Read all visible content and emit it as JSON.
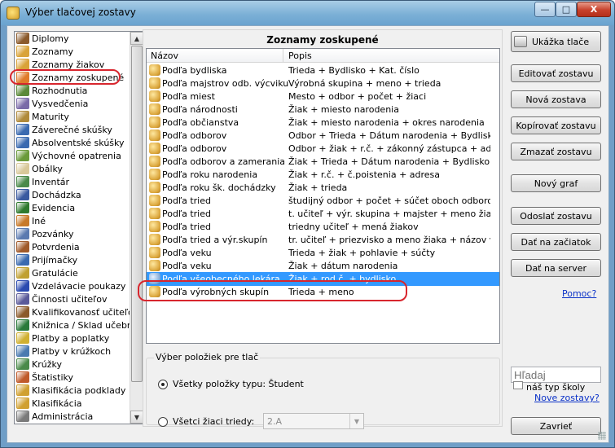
{
  "window": {
    "title": "Výber tlačovej zostavy",
    "controls": {
      "minimize": "—",
      "maximize": "□",
      "close": "X"
    }
  },
  "sidebar": {
    "items": [
      {
        "label": "Diplomy",
        "icon": "diploma-icon",
        "color": "#8b5a2b"
      },
      {
        "label": "Zoznamy",
        "icon": "list-icon",
        "color": "#d9a338"
      },
      {
        "label": "Zoznamy žiakov",
        "icon": "students-list-icon",
        "color": "#d9a338"
      },
      {
        "label": "Zoznamy zoskupené",
        "icon": "grouped-list-icon",
        "color": "#e07b2a"
      },
      {
        "label": "Rozhodnutia",
        "icon": "decision-icon",
        "color": "#5c8a3a"
      },
      {
        "label": "Vysvedčenia",
        "icon": "certificate-icon",
        "color": "#7a6aa8"
      },
      {
        "label": "Maturity",
        "icon": "graduation-icon",
        "color": "#b08a3a"
      },
      {
        "label": "Záverečné skúšky",
        "icon": "final-exam-icon",
        "color": "#3a6ab0"
      },
      {
        "label": "Absolventské skúšky",
        "icon": "graduate-exam-icon",
        "color": "#3a6ab0"
      },
      {
        "label": "Výchovné opatrenia",
        "icon": "measures-icon",
        "color": "#6a9a3a"
      },
      {
        "label": "Obálky",
        "icon": "envelope-icon",
        "color": "#d8c89a"
      },
      {
        "label": "Inventár",
        "icon": "inventory-icon",
        "color": "#4a8a4a"
      },
      {
        "label": "Dochádzka",
        "icon": "attendance-icon",
        "color": "#3a5aa0"
      },
      {
        "label": "Evidencia",
        "icon": "records-icon",
        "color": "#2f7a2f"
      },
      {
        "label": "Iné",
        "icon": "other-icon",
        "color": "#c87a2a"
      },
      {
        "label": "Pozvánky",
        "icon": "invitation-icon",
        "color": "#5a7ab0"
      },
      {
        "label": "Potvrdenia",
        "icon": "confirmation-icon",
        "color": "#a05a2a"
      },
      {
        "label": "Prijímačky",
        "icon": "admissions-icon",
        "color": "#3a6ab0"
      },
      {
        "label": "Gratulácie",
        "icon": "congratulation-icon",
        "color": "#c0a030"
      },
      {
        "label": "Vzdelávacie poukazy",
        "icon": "voucher-icon",
        "color": "#2a4ab0"
      },
      {
        "label": "Činnosti učiteľov",
        "icon": "teacher-activity-icon",
        "color": "#5a5a9a"
      },
      {
        "label": "Kvalifikovanosť učiteľov",
        "icon": "qualification-icon",
        "color": "#8b5a2b"
      },
      {
        "label": "Knižnica / Sklad učebníc",
        "icon": "library-icon",
        "color": "#2a7a3a"
      },
      {
        "label": "Platby a poplatky",
        "icon": "payment-icon",
        "color": "#d0b030"
      },
      {
        "label": "Platby v krúžkoch",
        "icon": "club-payment-icon",
        "color": "#4a7ab0"
      },
      {
        "label": "Krúžky",
        "icon": "clubs-icon",
        "color": "#4a8a4a"
      },
      {
        "label": "Štatistiky",
        "icon": "statistics-icon",
        "color": "#c05a2a"
      },
      {
        "label": "Klasifikácia podklady",
        "icon": "grading-docs-icon",
        "color": "#d0a030"
      },
      {
        "label": "Klasifikácia",
        "icon": "grading-icon",
        "color": "#d0a030"
      },
      {
        "label": "Administrácia",
        "icon": "administration-icon",
        "color": "#7a7a7a"
      }
    ],
    "scroll_up": "▲",
    "scroll_down": "▼"
  },
  "main": {
    "title": "Zoznamy zoskupené",
    "columns": {
      "name": "Názov",
      "description": "Popis"
    },
    "rows": [
      {
        "name": "Podľa bydliska",
        "desc": "Trieda + Bydlisko + Kat. číslo"
      },
      {
        "name": "Podľa majstrov odb. výcviku",
        "desc": "Výrobná skupina + meno + trieda"
      },
      {
        "name": "Podľa miest",
        "desc": "Mesto + odbor + počet + žiaci"
      },
      {
        "name": "Podľa národnosti",
        "desc": "Žiak + miesto narodenia"
      },
      {
        "name": "Podľa občianstva",
        "desc": "Žiak + miesto narodenia + okres narodenia"
      },
      {
        "name": "Podľa odborov",
        "desc": "Odbor + Trieda + Dátum narodenia + Bydlisko"
      },
      {
        "name": "Podľa odborov",
        "desc": "Odbor + žiak + r.č. + zákonný zástupca + adresa"
      },
      {
        "name": "Podľa odborov a zamerania",
        "desc": "Žiak + Trieda + Dátum narodenia + Bydlisko"
      },
      {
        "name": "Podľa roku narodenia",
        "desc": "Žiak + r.č. + č.poistenia + adresa"
      },
      {
        "name": "Podľa roku šk. dochádzky",
        "desc": "Žiak + trieda"
      },
      {
        "name": "Podľa tried",
        "desc": "študijný odbor + počet + súčet oboch odborov"
      },
      {
        "name": "Podľa tried",
        "desc": "t. učiteľ + výr. skupina + majster + meno žiaka + ..."
      },
      {
        "name": "Podľa tried",
        "desc": "triedny učiteľ + mená žiakov"
      },
      {
        "name": "Podľa tried a výr.skupín",
        "desc": "tr. učiteľ + priezvisko a meno žiaka + názov výr...."
      },
      {
        "name": "Podľa veku",
        "desc": "Trieda + žiak + pohlavie + súčty"
      },
      {
        "name": "Podľa veku",
        "desc": "Žiak + dátum narodenia"
      },
      {
        "name": "Podľa všeobecného lekára",
        "desc": "Žiak + rod.č. + bydlisko"
      },
      {
        "name": "Podľa výrobných skupín",
        "desc": "Trieda + meno"
      }
    ],
    "selected_index": 16,
    "group": {
      "label": "Výber položiek pre tlač",
      "option_all": "Všetky položky typu: Študent",
      "option_class": "Všetci žiaci triedy:",
      "class_value": "2.A"
    }
  },
  "actions": {
    "print_preview": "Ukážka tlače",
    "edit": "Editovať zostavu",
    "new": "Nová zostava",
    "copy": "Kopírovať zostavu",
    "delete": "Zmazať zostavu",
    "new_graph": "Nový graf",
    "send": "Odoslať zostavu",
    "to_start": "Dať na začiatok",
    "to_server": "Dať na server",
    "help": "Pomoc?",
    "search_placeholder": "Hľadaj",
    "own_type": "náš typ školy",
    "new_reports": "Nove zostavy?",
    "close": "Zavrieť"
  },
  "colors": {
    "selection": "#3399ff",
    "annotation": "#d8262e",
    "link": "#0b32c8"
  }
}
